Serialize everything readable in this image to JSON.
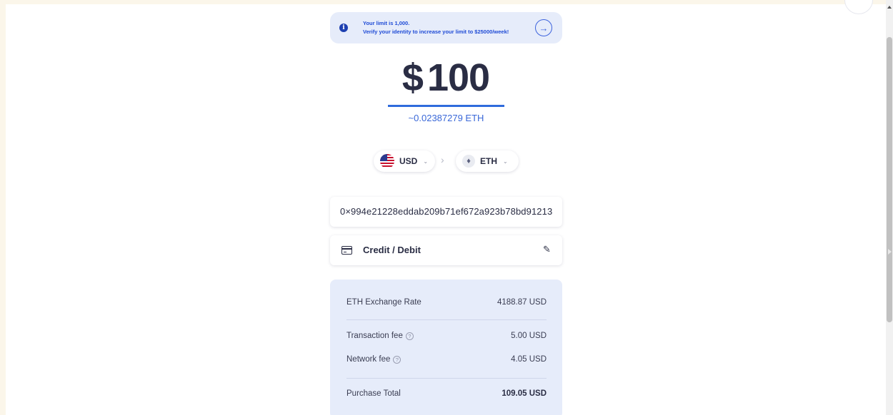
{
  "notice": {
    "line1": "Your limit is 1,000.",
    "line2": "Verify your identity to increase your limit to $25000/week!",
    "info_glyph": "i",
    "arrow_glyph": "→"
  },
  "amount": {
    "currency_symbol": "$",
    "value": "100"
  },
  "estimate": "~0.02387279 ETH",
  "currencies": {
    "from": {
      "code": "USD",
      "chevron": "⌄"
    },
    "separator": "›",
    "to": {
      "code": "ETH",
      "glyph": "♦",
      "chevron": "⌄"
    }
  },
  "wallet_address": "0×994e21228eddab209b71ef672a923b78bd91213",
  "payment": {
    "label": "Credit / Debit",
    "edit_glyph": "✎"
  },
  "summary": {
    "exchange_rate": {
      "label": "ETH Exchange Rate",
      "value": "4188.87 USD"
    },
    "transaction_fee": {
      "label": "Transaction fee",
      "value": "5.00 USD"
    },
    "network_fee": {
      "label": "Network fee",
      "value": "4.05 USD"
    },
    "help_glyph": "?",
    "total": {
      "label": "Purchase Total",
      "value": "109.05 USD"
    }
  },
  "colors": {
    "accent": "#2f6bdc",
    "notice_bg": "#e6ecfa",
    "summary_bg": "#e6ecfa",
    "text_dark": "#2a2d44"
  }
}
